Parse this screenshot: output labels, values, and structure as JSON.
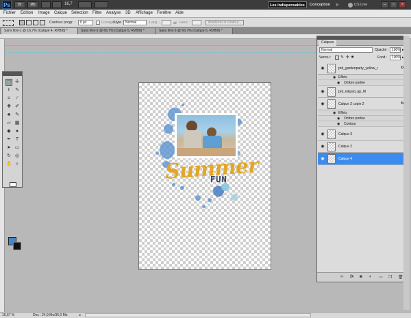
{
  "topbar": {
    "app_icon": "Ps",
    "zoom": "16,7",
    "workspace_active": "Les indispensables",
    "workspace_other": "Conception",
    "more": "»",
    "cslive": "CS Live",
    "icons": [
      "br-icon",
      "mini-bridge-icon",
      "zoom-level-icon",
      "arrange-documents-icon",
      "screen-mode-icon",
      "minimize-icon",
      "restore-icon",
      "close-icon"
    ]
  },
  "menu": [
    "Fichier",
    "Edition",
    "Image",
    "Calque",
    "Sélection",
    "Filtre",
    "Analyse",
    "3D",
    "Affichage",
    "Fenêtre",
    "Aide"
  ],
  "options": {
    "feather_label": "Contour progr. :",
    "feather_value": "0 px",
    "antialias_label": "Lissage",
    "style_label": "Style :",
    "style_value": "Normal",
    "width_label": "Larg. :",
    "height_label": "Haut. :",
    "refine_button": "Améliorer le contour..."
  },
  "tabs": [
    {
      "label": "Sans titre-1 @ 16,7% (Calque 4, RVB/8) *",
      "active": true
    },
    {
      "label": "Sans titre-2 @ 66,7% (Calque 5, RVB/8) *",
      "active": false
    },
    {
      "label": "Sans titre-3 @ 66,7% (Calque 5, RVB/8) *",
      "active": false
    }
  ],
  "canvas": {
    "title_word": "Summer",
    "sub_word": "FUN"
  },
  "layers_panel": {
    "tab": "Calques",
    "blend_mode": "Normal",
    "opacity_label": "Opacité :",
    "opacity_value": "100%",
    "lock_label": "Verrou :",
    "fill_label": "Fond :",
    "fill_value": "100%",
    "layers": [
      {
        "name": "prd_gardenparty_yellow_r",
        "fx": "fx",
        "effects_label": "Effets",
        "effects": [
          "Ombre portée"
        ],
        "active": false
      },
      {
        "name": "prd_inkpad_ap_M",
        "fx": "",
        "effects_label": "",
        "effects": [],
        "active": false
      },
      {
        "name": "Calque 2 copie 2",
        "fx": "fx",
        "effects_label": "Effets",
        "effects": [
          "Ombre portée",
          "Contour"
        ],
        "active": false
      },
      {
        "name": "Calque 3",
        "fx": "",
        "effects_label": "",
        "effects": [],
        "active": false
      },
      {
        "name": "Calque 2",
        "fx": "",
        "effects_label": "",
        "effects": [],
        "active": false
      },
      {
        "name": "Calque 4",
        "fx": "",
        "effects_label": "",
        "effects": [],
        "active": true
      }
    ],
    "footer_icons": [
      "link-layers-icon",
      "fx-icon",
      "add-mask-icon",
      "adjustment-layer-icon",
      "group-icon",
      "new-layer-icon",
      "delete-icon"
    ]
  },
  "status": {
    "zoom": "16,67 %",
    "doc": "Doc : 24,9 Mo/36,0 Mo"
  }
}
